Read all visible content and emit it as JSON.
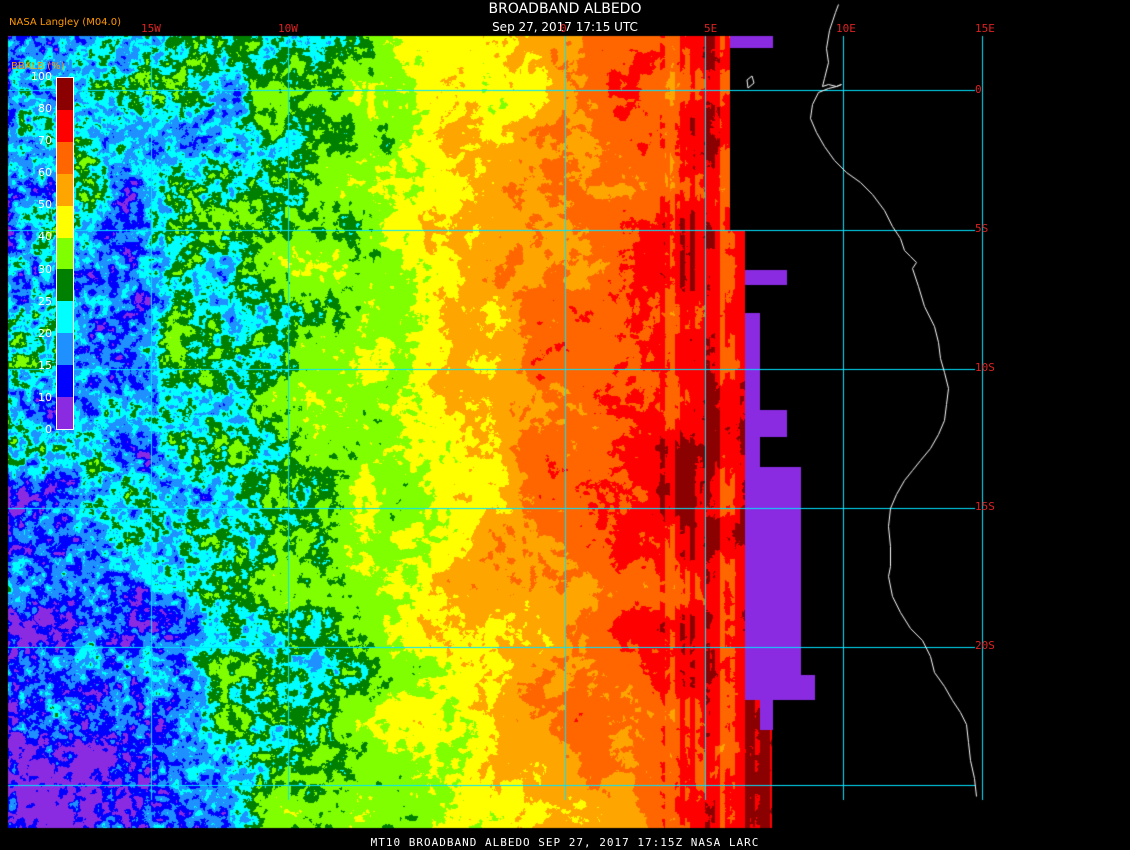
{
  "header": {
    "title": "BROADBAND ALBEDO",
    "subtitle": "Sep 27, 2017 17:15 UTC",
    "producer": "NASA Langley (M04.0)"
  },
  "footer": {
    "text": "MT10  BROADBAND ALBEDO   SEP 27, 2017 17:15Z   NASA LARC"
  },
  "legend": {
    "title": "BBALB (%)",
    "ticks": [
      "0",
      "10",
      "15",
      "20",
      "25",
      "30",
      "40",
      "50",
      "60",
      "70",
      "80",
      "100"
    ],
    "colors": [
      "#8a2be2",
      "#0000ff",
      "#1e90ff",
      "#00ffff",
      "#008000",
      "#7fff00",
      "#ffff00",
      "#ffa500",
      "#ff6600",
      "#ff0000",
      "#8b0000"
    ]
  },
  "grid": {
    "longitudes": [
      {
        "label": "15W",
        "value": -15
      },
      {
        "label": "10W",
        "value": -10
      },
      {
        "label": "0",
        "value": 0
      },
      {
        "label": "5E",
        "value": 5
      },
      {
        "label": "10E",
        "value": 10
      },
      {
        "label": "15E",
        "value": 15
      }
    ],
    "latitudes": [
      {
        "label": "0",
        "value": 0
      },
      {
        "label": "5S",
        "value": -5
      },
      {
        "label": "10S",
        "value": -10
      },
      {
        "label": "15S",
        "value": -15
      },
      {
        "label": "20S",
        "value": -20
      }
    ],
    "line_color": "#00e5ff"
  },
  "colors": {
    "background": "#000000",
    "coastline": "#ffffff",
    "missing": "#8a2be2"
  }
}
